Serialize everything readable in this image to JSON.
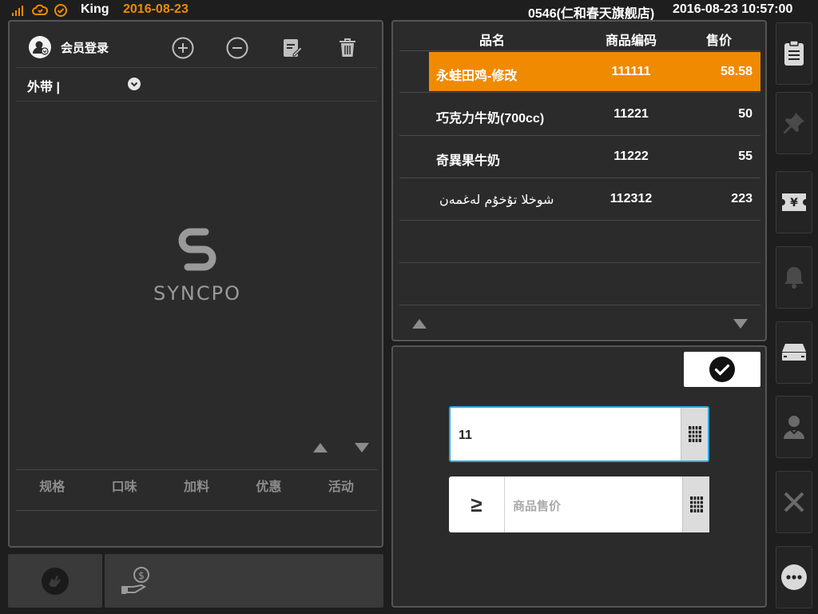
{
  "status_bar": {
    "user": "King",
    "date": "2016-08-23",
    "store": "0546(仁和春天旗舰店)",
    "datetime": "2016-08-23 10:57:00",
    "accent": "#f08a00"
  },
  "left_panel": {
    "member_login_label": "会员登录",
    "toolbar_icons": [
      "plus-circle-icon",
      "minus-circle-icon",
      "edit-icon",
      "trash-icon"
    ],
    "order_type": "外带 |",
    "logo_text": "SYNCPO",
    "tabs": [
      "规格",
      "口味",
      "加料",
      "优惠",
      "活动"
    ]
  },
  "product_table": {
    "headers": {
      "name": "品名",
      "code": "商品编码",
      "price": "售价"
    },
    "rows": [
      {
        "name": "永蛙田鸡-修改",
        "code": "111111",
        "price": "58.58",
        "selected": true
      },
      {
        "name": "巧克力牛奶(700cc)",
        "code": "11221",
        "price": "50",
        "selected": false
      },
      {
        "name": "奇異果牛奶",
        "code": "11222",
        "price": "55",
        "selected": false
      },
      {
        "name": "شوخلا تۇخۇم لەغمەن",
        "code": "112312",
        "price": "223",
        "selected": false
      }
    ],
    "selected_color": "#f08a00"
  },
  "input_panel": {
    "code_value": "11",
    "price_operator": "≥",
    "price_placeholder": "商品售价",
    "focus_color": "#29a8e0"
  },
  "right_rail": [
    "clipboard-icon",
    "pin-icon",
    "yen-ticket-icon",
    "bell-icon",
    "drawer-icon",
    "cashier-icon",
    "close-icon",
    "more-icon"
  ]
}
